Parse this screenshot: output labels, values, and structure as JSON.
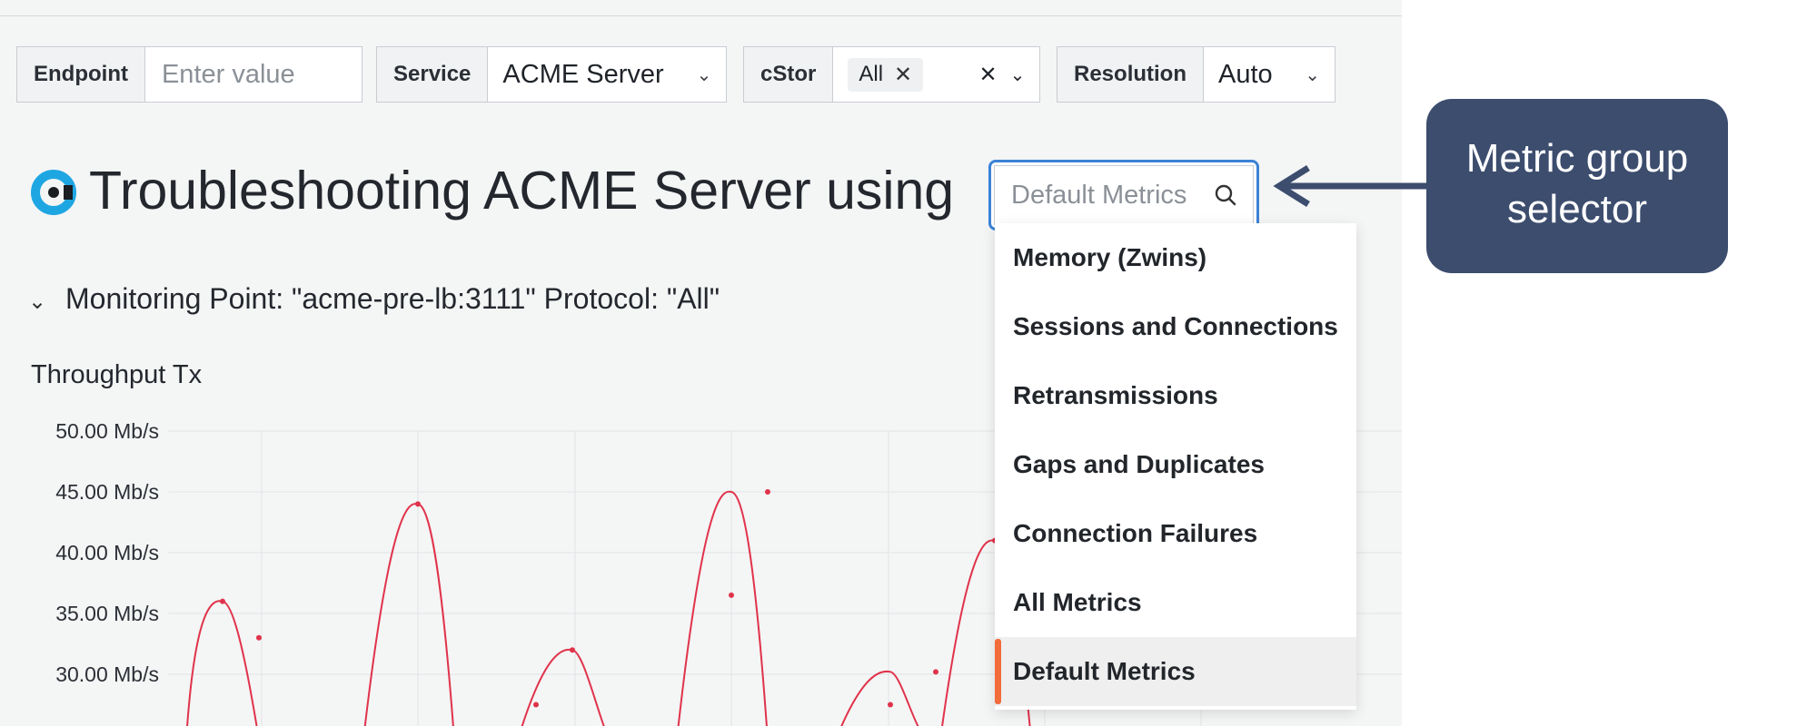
{
  "filters": {
    "endpoint": {
      "label": "Endpoint",
      "placeholder": "Enter value"
    },
    "service": {
      "label": "Service",
      "value": "ACME Server"
    },
    "cstor": {
      "label": "cStor",
      "chip": "All"
    },
    "resolution": {
      "label": "Resolution",
      "value": "Auto"
    }
  },
  "heading": {
    "title": "Troubleshooting ACME Server using",
    "metric_group_placeholder": "Default Metrics"
  },
  "dropdown": {
    "items": [
      {
        "label": "Memory (Zwins)"
      },
      {
        "label": "Sessions and Connections"
      },
      {
        "label": "Retransmissions"
      },
      {
        "label": "Gaps and Duplicates"
      },
      {
        "label": "Connection Failures"
      },
      {
        "label": "All Metrics"
      },
      {
        "label": "Default Metrics",
        "selected": true
      }
    ]
  },
  "monitoring": {
    "title": "Monitoring Point: \"acme-pre-lb:3111\" Protocol: \"All\""
  },
  "chart_data": {
    "type": "line",
    "title": "Throughput Tx",
    "y_ticks": [
      "50.00 Mb/s",
      "45.00 Mb/s",
      "40.00 Mb/s",
      "35.00 Mb/s",
      "30.00 Mb/s"
    ],
    "ylim": [
      25,
      50
    ],
    "series": [
      {
        "color": "#e0334b",
        "points": [
          [
            1,
            36.0
          ],
          [
            2,
            33.0
          ],
          [
            3,
            44.0
          ],
          [
            4,
            27.5
          ],
          [
            5,
            32.0
          ],
          [
            6,
            36.5
          ],
          [
            7,
            45.0
          ],
          [
            8,
            27.5
          ],
          [
            9,
            30.2
          ],
          [
            10,
            41.0
          ]
        ]
      }
    ]
  },
  "annotation": {
    "text": "Metric group selector"
  },
  "colors": {
    "accent": "#3b82d6",
    "selected_marker": "#f26b3a",
    "callout": "#3c4d6e",
    "line": "#e0334b"
  }
}
